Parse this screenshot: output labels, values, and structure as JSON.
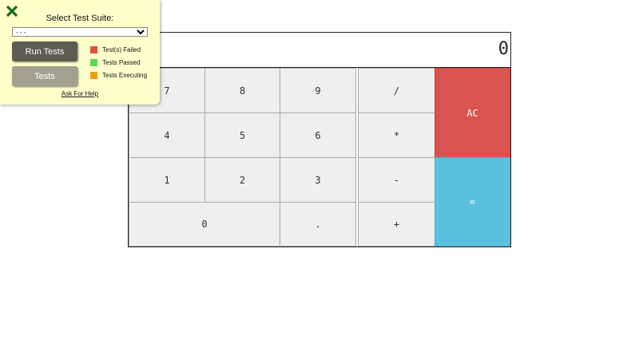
{
  "calculator": {
    "display": "0",
    "keys": {
      "seven": "7",
      "eight": "8",
      "nine": "9",
      "divide": "/",
      "four": "4",
      "five": "5",
      "six": "6",
      "multiply": "*",
      "one": "1",
      "two": "2",
      "three": "3",
      "subtract": "-",
      "zero": "0",
      "decimal": ".",
      "add": "+",
      "clear": "AC",
      "equals": "="
    },
    "colors": {
      "clear": "#d9534f",
      "equals": "#5bc0de",
      "key_bg": "#efefef"
    }
  },
  "test_panel": {
    "title": "Select Test Suite:",
    "select_value": "- - -",
    "run_button": "Run Tests",
    "tests_button": "Tests",
    "legend": [
      {
        "label": "Test(s) Failed",
        "color": "#e74c3c"
      },
      {
        "label": "Tests Passed",
        "color": "#5cd65c"
      },
      {
        "label": "Tests Executing",
        "color": "#f39c12"
      }
    ],
    "help_link": "Ask For Help",
    "close_icon": "close-x-icon",
    "background": "#ffffcc"
  }
}
